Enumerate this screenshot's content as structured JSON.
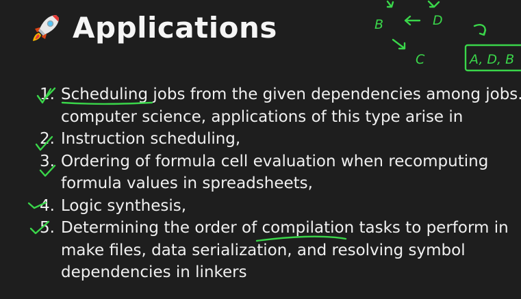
{
  "slide": {
    "title": "Applications",
    "title_icon": "rocket-icon"
  },
  "applications": [
    {
      "number": "1.",
      "lines": [
        "Scheduling jobs from the given dependencies among jobs. In",
        "computer science, applications of this type arise in"
      ]
    },
    {
      "number": "2.",
      "lines": [
        "Instruction scheduling,"
      ]
    },
    {
      "number": "3.",
      "lines": [
        "Ordering of formula cell evaluation when recomputing",
        "formula values in spreadsheets,"
      ]
    },
    {
      "number": "4.",
      "lines": [
        "Logic synthesis,"
      ]
    },
    {
      "number": "5.",
      "lines": [
        "Determining the order of compilation tasks to perform in",
        "make files, data serialization, and resolving symbol",
        "dependencies in linkers"
      ]
    }
  ],
  "annotations": {
    "color": "#3ad64a",
    "graph_labels": [
      "B",
      "D",
      "C"
    ],
    "order_box": "A, D, B"
  }
}
